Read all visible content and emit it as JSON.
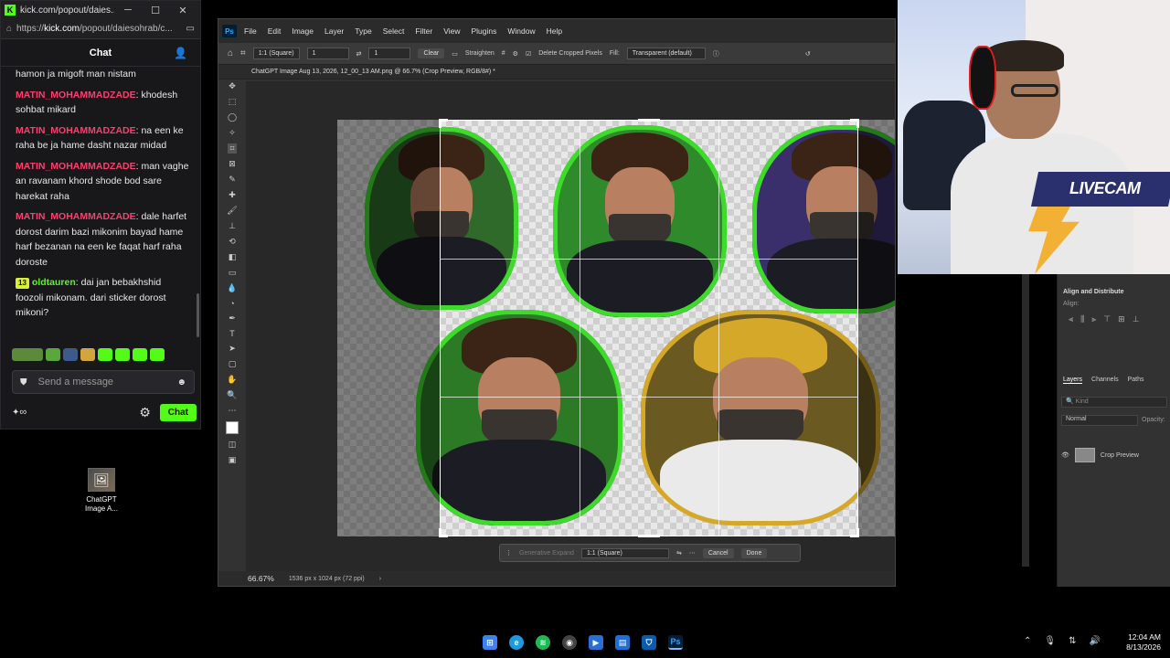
{
  "kick": {
    "window_title": "kick.com/popout/daies...",
    "url_prefix": "https://",
    "url_domain": "kick.com",
    "url_rest": "/popout/daiesohrab/c...",
    "header": "Chat",
    "messages": [
      {
        "user": "",
        "text": "hamon ja migoft man nistam"
      },
      {
        "user": "MATIN_MOHAMMADZADE",
        "text": "khodesh sohbat mikard"
      },
      {
        "user": "MATIN_MOHAMMADZADE",
        "text": "na een ke raha be ja hame dasht nazar midad"
      },
      {
        "user": "MATIN_MOHAMMADZADE",
        "text": "man vaghe an ravanam khord shode bod sare harekat raha"
      },
      {
        "user": "MATIN_MOHAMMADZADE",
        "text": "dale harfet dorost darim bazi mikonim bayad hame harf bezanan na een ke faqat harf raha doroste"
      },
      {
        "user": "oldtauren",
        "badge": "13",
        "text": "dai jan bebakhshid foozoli mikonam. dari sticker dorost mikoni?"
      }
    ],
    "send_placeholder": "Send a message",
    "chat_button": "Chat",
    "infinity": "∞"
  },
  "desktop": {
    "icon_label_1": "ChatGPT",
    "icon_label_2": "Image A..."
  },
  "photoshop": {
    "menu": [
      "File",
      "Edit",
      "Image",
      "Layer",
      "Type",
      "Select",
      "Filter",
      "View",
      "Plugins",
      "Window",
      "Help"
    ],
    "options": {
      "ratio": "1:1 (Square)",
      "w": "1",
      "h": "1",
      "clear": "Clear",
      "straighten": "Straighten",
      "delete_cropped": "Delete Cropped Pixels",
      "fill_label": "Fill:",
      "fill_value": "Transparent (default)"
    },
    "doc_tab": "ChatGPT Image Aug 13, 2026, 12_00_13 AM.png @ 66.7% (Crop Preview, RGB/8#) *",
    "context_bar": {
      "generative_expand": "Generative Expand",
      "ratio": "1:1 (Square)",
      "cancel": "Cancel",
      "done": "Done"
    },
    "status": {
      "zoom": "66.67%",
      "doc_info": "1536 px x 1024 px (72 ppi)"
    },
    "panels": {
      "align_title": "Align and Distribute",
      "align_sub": "Align:",
      "tabs": [
        "Layers",
        "Channels",
        "Paths"
      ],
      "kind": "Kind",
      "blend_mode": "Normal",
      "opacity": "Opacity:",
      "layer_name": "Crop Preview"
    }
  },
  "webcam": {
    "overlay_text": "LIVECAM"
  },
  "taskbar": {
    "time": "12:04 AM",
    "date": "8/13/2026"
  }
}
